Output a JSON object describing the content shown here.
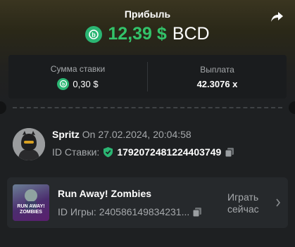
{
  "header": {
    "title": "Прибыль",
    "amount": "12,39 $",
    "currency": "BCD",
    "coin_icon": "bc-coin-icon",
    "share_icon": "share-arrow-icon"
  },
  "stats": {
    "bet_amount_label": "Сумма ставки",
    "bet_amount_value": "0,30 $",
    "payout_label": "Выплата",
    "payout_value": "42.3076 x"
  },
  "user": {
    "name": "Spritz",
    "date_prefix": "On",
    "datetime": "27.02.2024, 20:04:58",
    "bet_id_label": "ID Ставки:",
    "bet_id": "1792072481224403749"
  },
  "game": {
    "name": "Run Away! Zombies",
    "thumb_text": "RUN AWAY! ZOMBIES",
    "id_label": "ID Игры:",
    "id_value": "240586149834231...",
    "play_label": "Играть сейчас"
  },
  "colors": {
    "accent_green": "#33c36a",
    "coin_green": "#2bb673",
    "muted": "#a5a8ab"
  }
}
